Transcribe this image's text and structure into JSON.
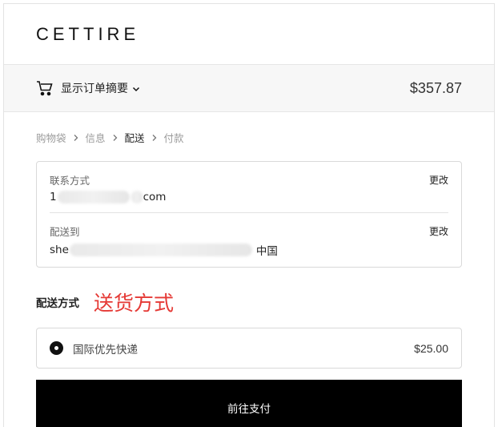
{
  "header": {
    "logo": "CETTIRE"
  },
  "summary": {
    "label": "显示订单摘要",
    "total": "$357.87",
    "icon": "cart-icon"
  },
  "breadcrumb": [
    {
      "label": "购物袋",
      "active": false
    },
    {
      "label": "信息",
      "active": false
    },
    {
      "label": "配送",
      "active": true
    },
    {
      "label": "付款",
      "active": false
    }
  ],
  "contact": {
    "label": "联系方式",
    "value_prefix": "1",
    "value_suffix": "om",
    "value_mid": "c",
    "change": "更改"
  },
  "ship_to": {
    "label": "配送到",
    "value_prefix": "she",
    "value_suffix": "中国",
    "change": "更改"
  },
  "shipping_method": {
    "title": "配送方式",
    "annotation": "送货方式",
    "option_name": "国际优先快递",
    "option_price": "$25.00",
    "selected": true
  },
  "continue_button": "前往支付",
  "colors": {
    "annotation": "#e53935",
    "button_bg": "#000000",
    "summary_bg": "#f7f7f7"
  }
}
